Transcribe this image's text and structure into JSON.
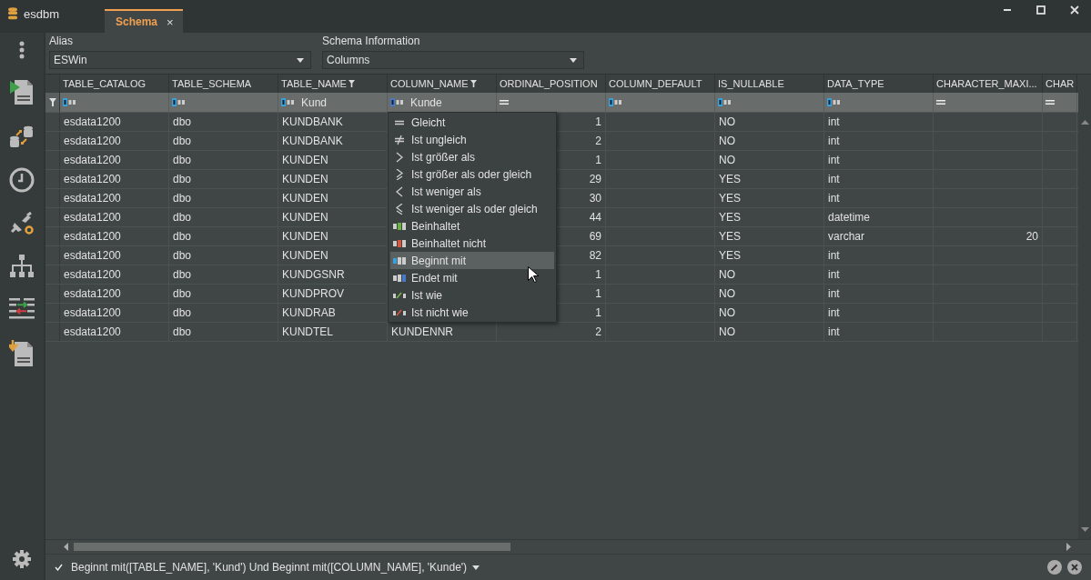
{
  "app": {
    "title": "esdbm"
  },
  "tabs": [
    {
      "label": "Schema",
      "selected": true,
      "close": "×"
    }
  ],
  "fields": [
    {
      "label": "Alias",
      "value": "ESWin"
    },
    {
      "label": "Schema Information",
      "value": "Columns"
    }
  ],
  "grid": {
    "columns": [
      {
        "label": "TABLE_CATALOG",
        "filtered": false,
        "filter": {
          "kind": "text"
        }
      },
      {
        "label": "TABLE_SCHEMA",
        "filtered": false,
        "filter": {
          "kind": "text"
        }
      },
      {
        "label": "TABLE_NAME",
        "filtered": true,
        "filter": {
          "kind": "text",
          "value": "Kund"
        }
      },
      {
        "label": "COLUMN_NAME",
        "filtered": true,
        "filter": {
          "kind": "text",
          "value": "Kunde"
        }
      },
      {
        "label": "ORDINAL_POSITION",
        "filtered": false,
        "filter": {
          "kind": "equals"
        }
      },
      {
        "label": "COLUMN_DEFAULT",
        "filtered": false,
        "filter": {
          "kind": "text"
        }
      },
      {
        "label": "IS_NULLABLE",
        "filtered": false,
        "filter": {
          "kind": "text"
        }
      },
      {
        "label": "DATA_TYPE",
        "filtered": false,
        "filter": {
          "kind": "text"
        }
      },
      {
        "label": "CHARACTER_MAXI...",
        "filtered": false,
        "filter": {
          "kind": "equals"
        }
      },
      {
        "label": "CHAR",
        "filtered": false,
        "filter": {
          "kind": "equals"
        }
      }
    ],
    "rows": [
      [
        "esdata1200",
        "dbo",
        "KUNDBANK",
        null,
        "1",
        null,
        "NO",
        "int",
        null,
        null
      ],
      [
        "esdata1200",
        "dbo",
        "KUNDBANK",
        null,
        "2",
        null,
        "NO",
        "int",
        null,
        null
      ],
      [
        "esdata1200",
        "dbo",
        "KUNDEN",
        null,
        "1",
        null,
        "NO",
        "int",
        null,
        null
      ],
      [
        "esdata1200",
        "dbo",
        "KUNDEN",
        null,
        "29",
        null,
        "YES",
        "int",
        null,
        null
      ],
      [
        "esdata1200",
        "dbo",
        "KUNDEN",
        null,
        "30",
        null,
        "YES",
        "int",
        null,
        null
      ],
      [
        "esdata1200",
        "dbo",
        "KUNDEN",
        null,
        "44",
        null,
        "YES",
        "datetime",
        null,
        null
      ],
      [
        "esdata1200",
        "dbo",
        "KUNDEN",
        null,
        "69",
        null,
        "YES",
        "varchar",
        "20",
        null
      ],
      [
        "esdata1200",
        "dbo",
        "KUNDEN",
        null,
        "82",
        null,
        "YES",
        "int",
        null,
        null
      ],
      [
        "esdata1200",
        "dbo",
        "KUNDGSNR",
        null,
        "1",
        null,
        "NO",
        "int",
        null,
        null
      ],
      [
        "esdata1200",
        "dbo",
        "KUNDPROV",
        null,
        "1",
        null,
        "NO",
        "int",
        null,
        null
      ],
      [
        "esdata1200",
        "dbo",
        "KUNDRAB",
        null,
        "1",
        null,
        "NO",
        "int",
        null,
        null
      ],
      [
        "esdata1200",
        "dbo",
        "KUNDTEL",
        "KUNDENNR",
        "2",
        null,
        "NO",
        "int",
        null,
        null
      ]
    ]
  },
  "filter_menu": {
    "items": [
      {
        "kind": "equals",
        "label": "Gleicht",
        "selected": false
      },
      {
        "kind": "not-equal",
        "label": "Ist ungleich",
        "selected": false
      },
      {
        "kind": "greater",
        "label": "Ist größer als",
        "selected": false
      },
      {
        "kind": "greater-equal",
        "label": "Ist größer als oder gleich",
        "selected": false
      },
      {
        "kind": "less",
        "label": "Ist weniger als",
        "selected": false
      },
      {
        "kind": "less-equal",
        "label": "Ist weniger als oder gleich",
        "selected": false
      },
      {
        "kind": "contains",
        "label": "Beinhaltet",
        "selected": false
      },
      {
        "kind": "not-contains",
        "label": "Beinhaltet nicht",
        "selected": false
      },
      {
        "kind": "begins",
        "label": "Beginnt mit",
        "selected": true
      },
      {
        "kind": "ends",
        "label": "Endet mit",
        "selected": false
      },
      {
        "kind": "like",
        "label": "Ist wie",
        "selected": false
      },
      {
        "kind": "not-like",
        "label": "Ist nicht wie",
        "selected": false
      }
    ]
  },
  "filter_bar": {
    "checked": true,
    "text": "Beginnt mit([TABLE_NAME], 'Kund') Und Beginnt mit([COLUMN_NAME], 'Kunde')"
  }
}
